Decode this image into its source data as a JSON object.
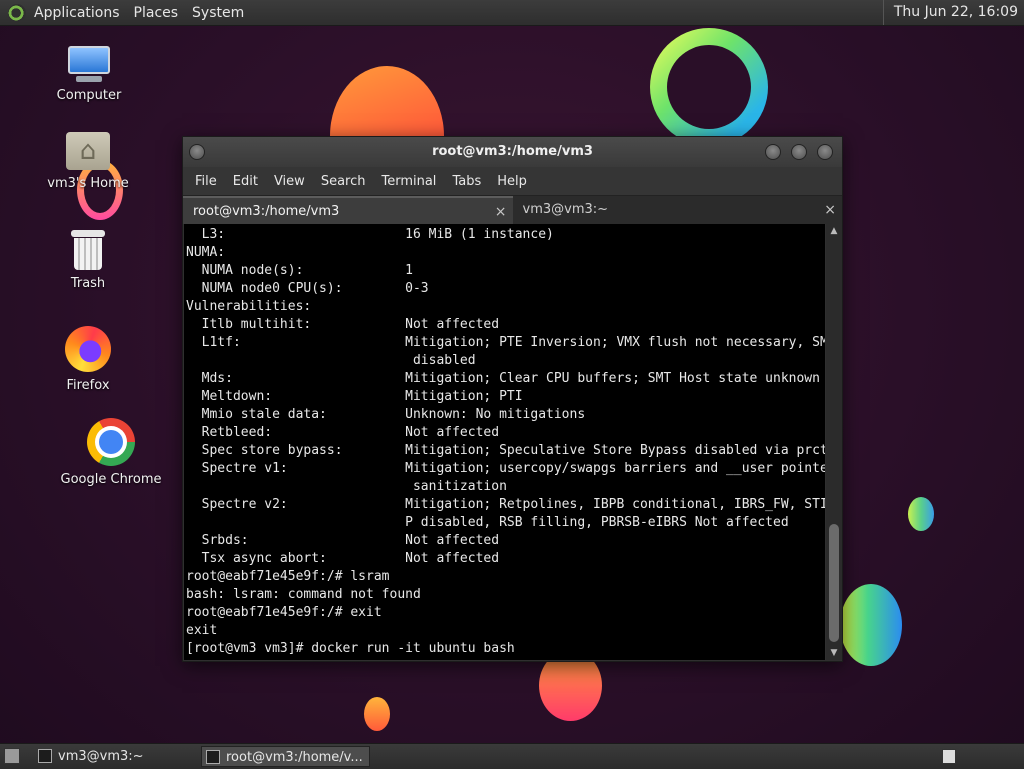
{
  "top_panel": {
    "menus": [
      "Applications",
      "Places",
      "System"
    ],
    "clock": "Thu Jun 22, 16:09"
  },
  "desktop_icons": [
    {
      "label": "Computer",
      "icon": "computer-icon"
    },
    {
      "label": "vm3's Home",
      "icon": "home-folder-icon"
    },
    {
      "label": "Trash",
      "icon": "trash-icon"
    },
    {
      "label": "Firefox",
      "icon": "firefox-icon"
    },
    {
      "label": "Google Chrome",
      "icon": "chrome-icon"
    }
  ],
  "terminal": {
    "title": "root@vm3:/home/vm3",
    "menu": [
      "File",
      "Edit",
      "View",
      "Search",
      "Terminal",
      "Tabs",
      "Help"
    ],
    "tabs": [
      {
        "label": "root@vm3:/home/vm3",
        "active": true
      },
      {
        "label": "vm3@vm3:~",
        "active": false
      }
    ],
    "tab_close": "×",
    "output": "  L3:                       16 MiB (1 instance)\nNUMA:\n  NUMA node(s):             1\n  NUMA node0 CPU(s):        0-3\nVulnerabilities:\n  Itlb multihit:            Not affected\n  L1tf:                     Mitigation; PTE Inversion; VMX flush not necessary, SMT\n                             disabled\n  Mds:                      Mitigation; Clear CPU buffers; SMT Host state unknown\n  Meltdown:                 Mitigation; PTI\n  Mmio stale data:          Unknown: No mitigations\n  Retbleed:                 Not affected\n  Spec store bypass:        Mitigation; Speculative Store Bypass disabled via prctl\n  Spectre v1:               Mitigation; usercopy/swapgs barriers and __user pointer\n                             sanitization\n  Spectre v2:               Mitigation; Retpolines, IBPB conditional, IBRS_FW, STIB\n                            P disabled, RSB filling, PBRSB-eIBRS Not affected\n  Srbds:                    Not affected\n  Tsx async abort:          Not affected\nroot@eabf71e45e9f:/# lsram\nbash: lsram: command not found\nroot@eabf71e45e9f:/# exit\nexit\n[root@vm3 vm3]# docker run -it ubuntu bash"
  },
  "taskbar": {
    "items": [
      {
        "label": "vm3@vm3:~",
        "active": false
      },
      {
        "label": "root@vm3:/home/v...",
        "active": true
      }
    ]
  },
  "colors": {
    "desktop_bg": "#2a0f28",
    "terminal_bg": "#000000",
    "terminal_fg": "#e8e8e8",
    "panel_bg": "#333333"
  }
}
